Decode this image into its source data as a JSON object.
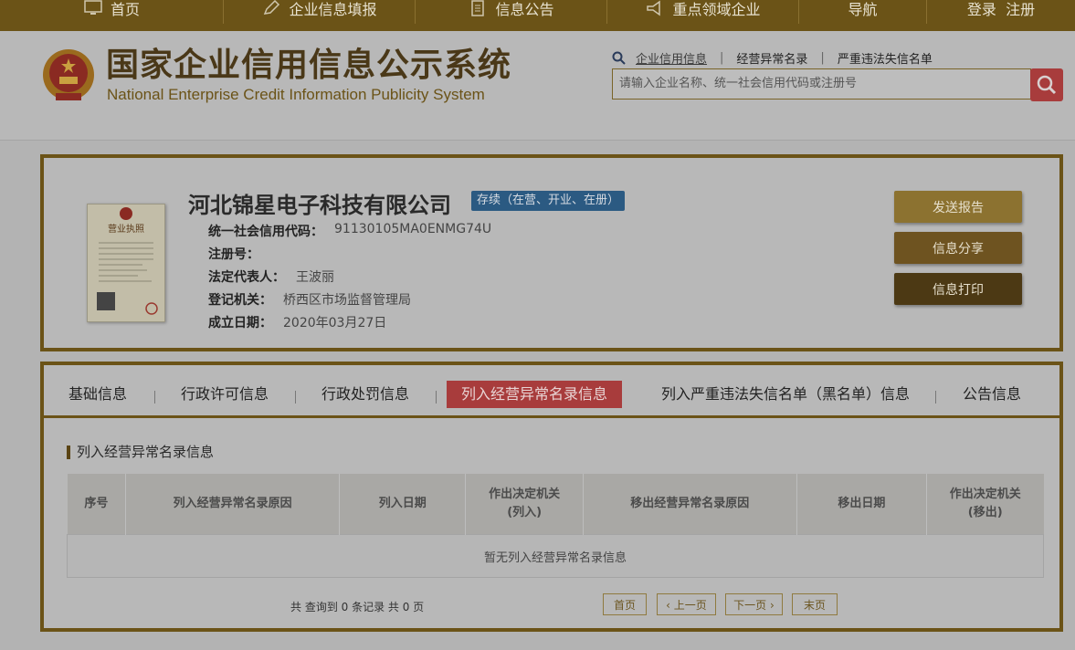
{
  "nav": {
    "items": [
      {
        "label": "首页",
        "icon": "monitor-icon"
      },
      {
        "label": "企业信息填报",
        "icon": "edit-icon"
      },
      {
        "label": "信息公告",
        "icon": "document-icon"
      },
      {
        "label": "重点领域企业",
        "icon": "megaphone-icon"
      },
      {
        "label": "导航",
        "icon": ""
      },
      {
        "label": "登录  注册",
        "icon": ""
      }
    ]
  },
  "header": {
    "title": "国家企业信用信息公示系统",
    "subtitle": "National Enterprise Credit Information Publicity System",
    "links": [
      "企业信用信息",
      "经营异常名录",
      "严重违法失信名单"
    ],
    "search_placeholder": "请输入企业名称、统一社会信用代码或注册号"
  },
  "company": {
    "name": "河北锦星电子科技有限公司",
    "status": "存续（在营、开业、在册）",
    "license_caption": "营业执照",
    "fields": [
      {
        "key": "统一社会信用代码：",
        "value": "91130105MA0ENMG74U"
      },
      {
        "key": "注册号：",
        "value": ""
      },
      {
        "key": "法定代表人：",
        "value": "王波丽"
      },
      {
        "key": "登记机关：",
        "value": "桥西区市场监督管理局"
      },
      {
        "key": "成立日期：",
        "value": "2020年03月27日"
      }
    ],
    "actions": {
      "send": "发送报告",
      "share": "信息分享",
      "print": "信息打印"
    },
    "action_colors": {
      "send": "#8c7230",
      "share": "#6e5320",
      "print": "#4c3914"
    }
  },
  "tabs": {
    "items": [
      "基础信息",
      "行政许可信息",
      "行政处罚信息",
      "列入经营异常名录信息",
      "列入严重违法失信名单（黑名单）信息",
      "公告信息"
    ],
    "active_index": 3
  },
  "section": {
    "title": "列入经营异常名录信息",
    "columns": [
      "序号",
      "列入经营异常名录原因",
      "列入日期",
      "作出决定机关\n(列入)",
      "移出经营异常名录原因",
      "移出日期",
      "作出决定机关\n(移出)"
    ],
    "empty_text": "暂无列入经营异常名录信息",
    "summary": "共 查询到 0 条记录 共 0 页",
    "pager": {
      "first": "首页",
      "prev": "上一页",
      "next": "下一页",
      "last": "末页"
    }
  }
}
